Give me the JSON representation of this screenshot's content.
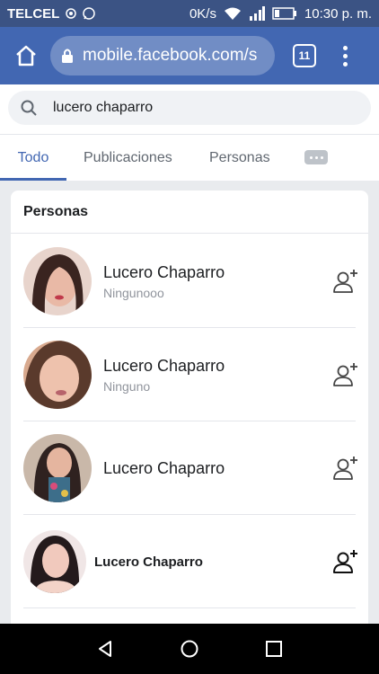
{
  "status_bar": {
    "carrier": "TELCEL",
    "speed": "0K/s",
    "time": "10:30 p. m."
  },
  "browser": {
    "url": "mobile.facebook.com/s",
    "tab_count": "11"
  },
  "search": {
    "query": "lucero chaparro"
  },
  "tabs": [
    {
      "label": "Todo",
      "active": true
    },
    {
      "label": "Publicaciones",
      "active": false
    },
    {
      "label": "Personas",
      "active": false
    }
  ],
  "section": {
    "title": "Personas"
  },
  "people": [
    {
      "name": "Lucero Chaparro",
      "subtitle": "Ningunooo"
    },
    {
      "name": "Lucero Chaparro",
      "subtitle": "Ninguno"
    },
    {
      "name": "Lucero Chaparro",
      "subtitle": ""
    },
    {
      "name": "Lucero Chaparro",
      "subtitle": ""
    }
  ],
  "colors": {
    "brand": "#4267b2",
    "status_bar": "#3b5384",
    "background": "#e9ebee"
  }
}
